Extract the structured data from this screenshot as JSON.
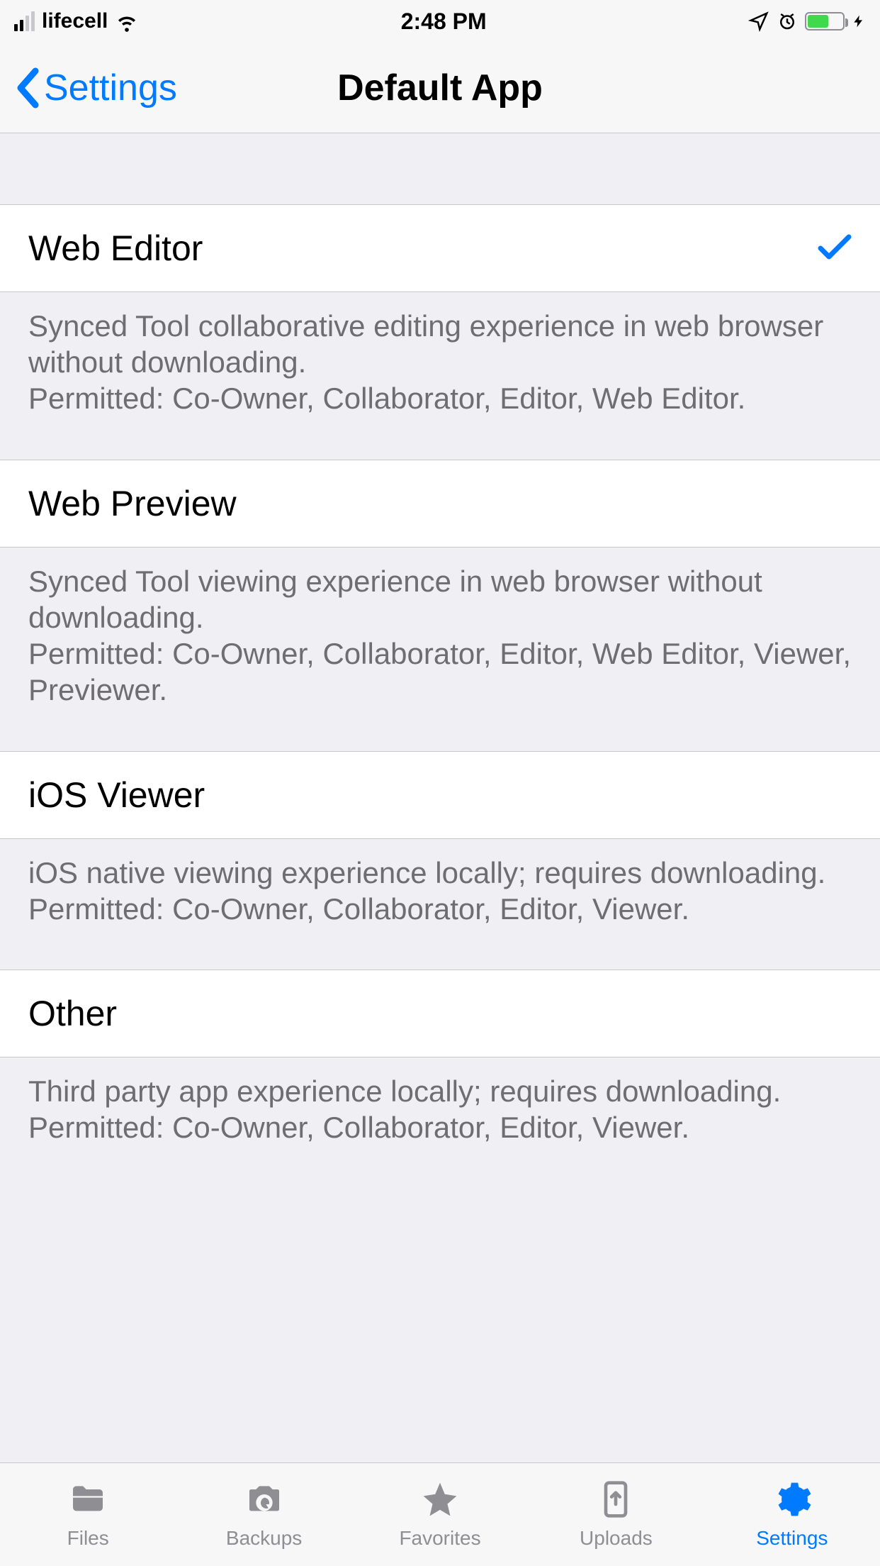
{
  "status_bar": {
    "carrier": "lifecell",
    "time": "2:48 PM"
  },
  "nav": {
    "back_label": "Settings",
    "title": "Default App"
  },
  "options": [
    {
      "title": "Web Editor",
      "selected": true,
      "description": "Synced Tool collaborative editing experience in web browser without downloading.\nPermitted: Co-Owner, Collaborator, Editor, Web Editor."
    },
    {
      "title": "Web Preview",
      "selected": false,
      "description": "Synced Tool viewing experience in web browser without downloading.\nPermitted: Co-Owner, Collaborator, Editor, Web Editor, Viewer, Previewer."
    },
    {
      "title": "iOS Viewer",
      "selected": false,
      "description": "iOS native viewing experience locally; requires downloading.\nPermitted: Co-Owner, Collaborator, Editor, Viewer."
    },
    {
      "title": "Other",
      "selected": false,
      "description": "Third party app experience locally; requires downloading.\nPermitted: Co-Owner, Collaborator, Editor, Viewer."
    }
  ],
  "tabs": [
    {
      "label": "Files"
    },
    {
      "label": "Backups"
    },
    {
      "label": "Favorites"
    },
    {
      "label": "Uploads"
    },
    {
      "label": "Settings"
    }
  ],
  "active_tab": "Settings"
}
